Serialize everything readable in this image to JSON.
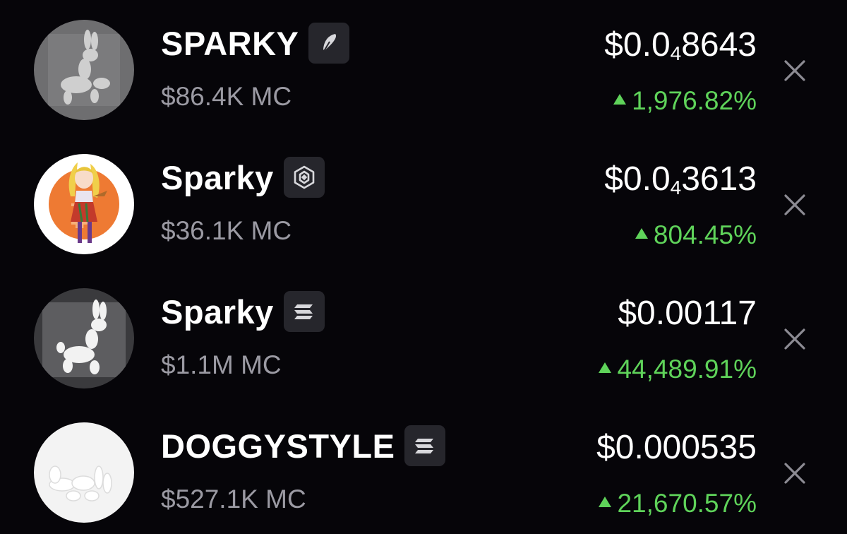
{
  "tokens": [
    {
      "name": "SPARKY",
      "chain_icon": "feather-icon",
      "market_cap": "$86.4K MC",
      "price_prefix": "$0.0",
      "price_zeros": "4",
      "price_digits": "8643",
      "change": "1,976.82%",
      "avatar": "balloon-dog-gray"
    },
    {
      "name": "Sparky",
      "chain_icon": "bnb-chain-icon",
      "market_cap": "$36.1K MC",
      "price_prefix": "$0.0",
      "price_zeros": "4",
      "price_digits": "3613",
      "change": "804.45%",
      "avatar": "anime-girl-orange"
    },
    {
      "name": "Sparky",
      "chain_icon": "solana-icon",
      "market_cap": "$1.1M MC",
      "price_text": "$0.00117",
      "change": "44,489.91%",
      "avatar": "balloon-dog-white-square"
    },
    {
      "name": "DOGGYSTYLE",
      "chain_icon": "solana-icon",
      "market_cap": "$527.1K MC",
      "price_text": "$0.000535",
      "change": "21,670.57%",
      "avatar": "balloon-dog-white-lying"
    }
  ],
  "colors": {
    "background": "#060509",
    "up_green": "#5fd35a",
    "muted_text": "#9b9aa3",
    "badge_bg": "#26262c"
  }
}
